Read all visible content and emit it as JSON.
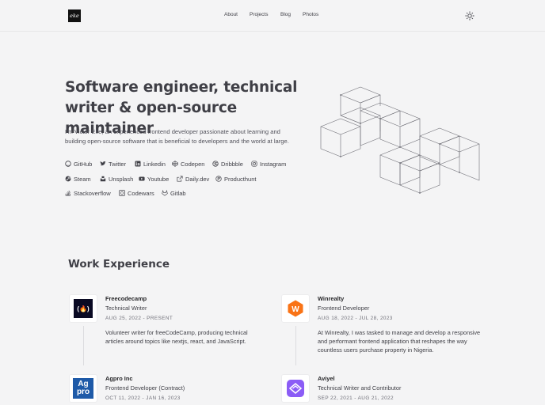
{
  "header": {
    "logo_text": "eke",
    "nav": [
      "About",
      "Projects",
      "Blog",
      "Photos"
    ]
  },
  "hero": {
    "title_line1": "Software engineer, technical",
    "title_line2": "writer & open-source maintainer",
    "description": "I'm Victor Eke, an experienced frontend developer passionate about learning and building open-source software that is beneficial to developers and the world at large.",
    "socials": [
      {
        "label": "GitHub",
        "icon": "github-icon"
      },
      {
        "label": "Twitter",
        "icon": "twitter-icon"
      },
      {
        "label": "Linkedin",
        "icon": "linkedin-icon"
      },
      {
        "label": "Codepen",
        "icon": "codepen-icon"
      },
      {
        "label": "Dribbble",
        "icon": "dribbble-icon"
      },
      {
        "label": "Instagram",
        "icon": "instagram-icon"
      },
      {
        "label": "Steam",
        "icon": "steam-icon"
      },
      {
        "label": "Unsplash",
        "icon": "unsplash-icon"
      },
      {
        "label": "Youtube",
        "icon": "youtube-icon"
      },
      {
        "label": "Daily.dev",
        "icon": "dailydev-icon"
      },
      {
        "label": "Producthunt",
        "icon": "producthunt-icon"
      },
      {
        "label": "Stackoverflow",
        "icon": "stackoverflow-icon"
      },
      {
        "label": "Codewars",
        "icon": "codewars-icon"
      },
      {
        "label": "Gitlab",
        "icon": "gitlab-icon"
      }
    ]
  },
  "work": {
    "heading": "Work Experience",
    "jobs": [
      {
        "company": "Freecodecamp",
        "role": "Technical Writer",
        "dates": "AUG 25, 2022 - PRESENT",
        "description": "Volunteer writer for freeCodeCamp, producing technical articles around topics like nextjs, react, and JavaScript.",
        "logo_icon": "freecodecamp-logo-icon",
        "logo_text": "(🔥)"
      },
      {
        "company": "Winrealty",
        "role": "Frontend Developer",
        "dates": "AUG 18, 2022 - JUL 28, 2023",
        "description": "At Winrealty, I was tasked to manage and develop a responsive and performant frontend application that reshapes the way countless users purchase property in Nigeria.",
        "logo_icon": "winrealty-logo-icon",
        "logo_text": "W"
      },
      {
        "company": "Agpro Inc",
        "role": "Frontend Developer (Contract)",
        "dates": "OCT 11, 2022 - JAN 16, 2023",
        "description": "",
        "logo_icon": "agpro-logo-icon",
        "logo_text": "Ag pro"
      },
      {
        "company": "Aviyel",
        "role": "Technical Writer and Contributor",
        "dates": "SEP 22, 2021 - AUG 21, 2022",
        "description": "",
        "logo_icon": "aviyel-logo-icon",
        "logo_text": ""
      }
    ]
  },
  "colors": {
    "background": "#f4f4f5",
    "text": "#27272a",
    "winrealty": "#f97316",
    "agpro": "#1e5aa8",
    "aviyel": "#8b5cf6"
  }
}
